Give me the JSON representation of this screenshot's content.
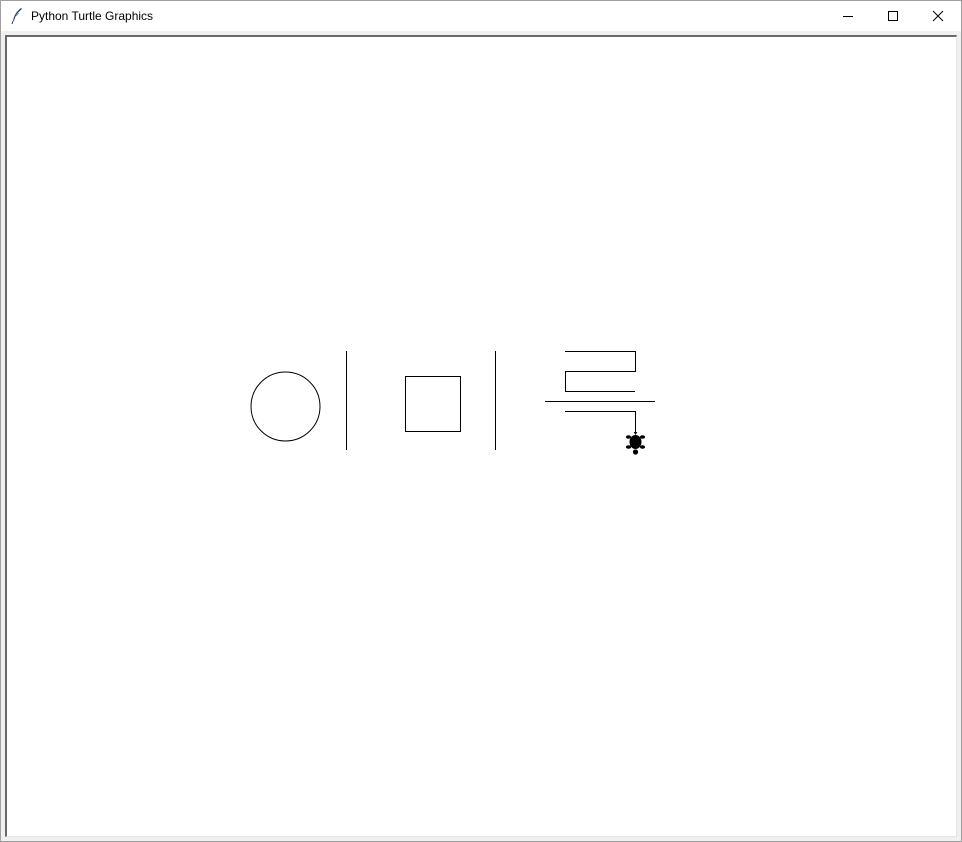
{
  "window": {
    "title": "Python Turtle Graphics",
    "app_icon": "feather-icon",
    "controls": {
      "minimize_icon": "minimize-icon",
      "maximize_icon": "maximize-icon",
      "close_icon": "close-icon"
    }
  },
  "canvas": {
    "background": "#ffffff",
    "pen_color": "#000000",
    "turtle": {
      "shape": "turtle",
      "heading": "down",
      "fill_color": "#000000"
    }
  }
}
